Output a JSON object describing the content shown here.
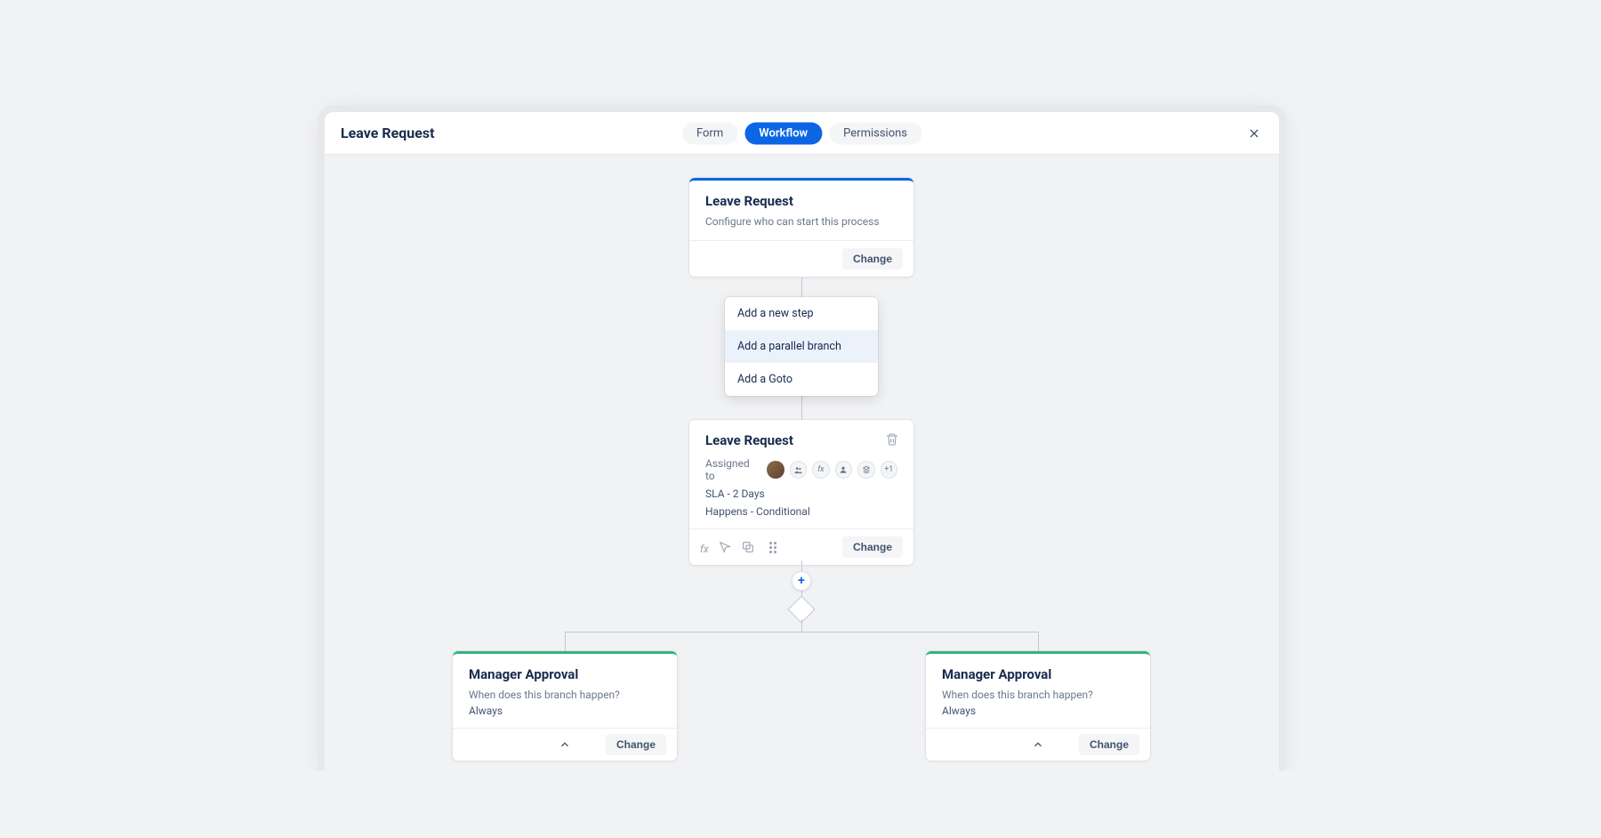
{
  "header": {
    "title": "Leave Request",
    "tabs": [
      "Form",
      "Workflow",
      "Permissions"
    ],
    "active_tab": "Workflow"
  },
  "start_card": {
    "title": "Leave Request",
    "subtitle": "Configure who can start this process",
    "change_label": "Change"
  },
  "add_menu": {
    "items": [
      "Add a new step",
      "Add a parallel branch",
      "Add a Goto"
    ],
    "hovered_index": 1
  },
  "step_card": {
    "title": "Leave Request",
    "assigned_label": "Assigned to",
    "more_count": "+1",
    "sla": "SLA - 2 Days",
    "happens": "Happens - Conditional",
    "change_label": "Change"
  },
  "branches": [
    {
      "title": "Manager Approval",
      "question": "When does this branch happen?",
      "answer": "Always",
      "change_label": "Change"
    },
    {
      "title": "Manager Approval",
      "question": "When does this branch happen?",
      "answer": "Always",
      "change_label": "Change"
    }
  ]
}
